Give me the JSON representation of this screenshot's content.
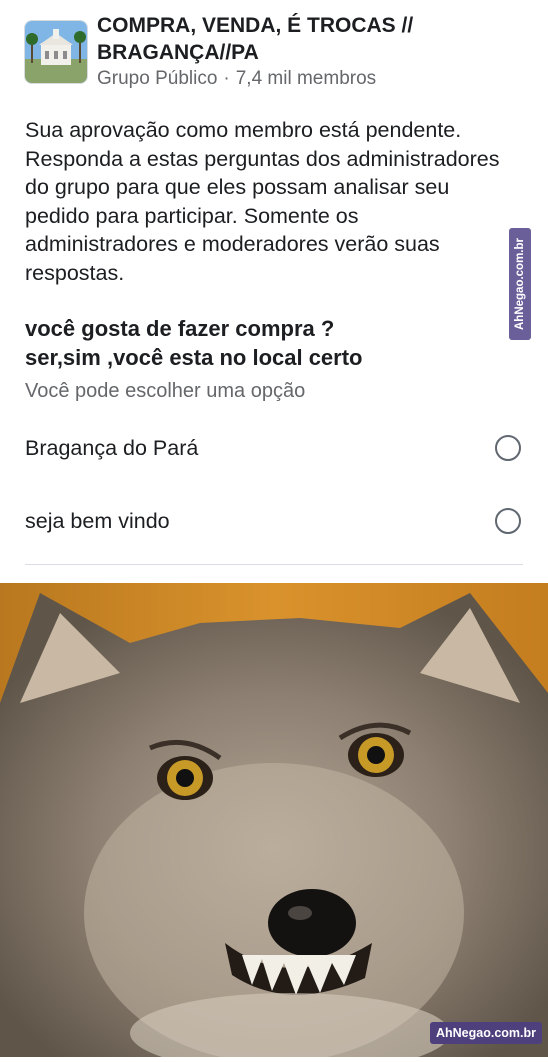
{
  "group": {
    "title": "COMPRA, VENDA, É TROCAS // BRAGANÇA//PA",
    "type": "Grupo Público",
    "separator": "·",
    "members": "7,4 mil membros"
  },
  "pending_message": "Sua aprovação como membro está pendente. Responda a estas perguntas dos administradores do grupo para que eles possam analisar seu pedido para participar. Somente os administradores e moderadores verão suas respostas.",
  "question": {
    "line1": "você gosta de fazer compra ?",
    "line2": "ser,sim ,você esta no local certo",
    "hint": "Você pode escolher uma opção",
    "options": [
      {
        "label": "Bragança do Pará",
        "selected": false
      },
      {
        "label": "seja bem vindo",
        "selected": false
      }
    ]
  },
  "watermark": {
    "side": "AhNegao.com.br",
    "bottom": "AhNegao.com.br"
  },
  "colors": {
    "text": "#1c1e21",
    "secondary": "#65676b",
    "watermark": "#4e3f7d"
  },
  "icons": {
    "group_photo": "group-cover-thumbnail",
    "photo": "grinning-wolf-photo"
  }
}
